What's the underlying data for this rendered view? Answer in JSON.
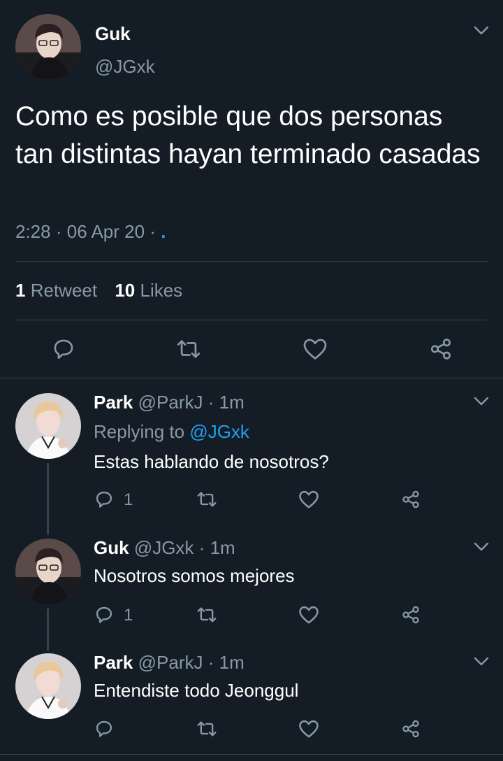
{
  "main_tweet": {
    "author_name": "Guk",
    "handle": "@JGxk",
    "text": "Como es posible que dos personas tan distintas hayan terminado casadas",
    "time": "2:28",
    "date": "06 Apr 20",
    "sep": "·",
    "dot": ".",
    "retweet_count": "1",
    "retweet_label": "Retweet",
    "likes_count": "10",
    "likes_label": "Likes"
  },
  "replies": [
    {
      "name": "Park",
      "handle": "@ParkJ",
      "sep": "·",
      "time": "1m",
      "replying_prefix": "Replying to",
      "replying_to": "@JGxk",
      "text": "Estas hablando de nosotros?",
      "reply_count": "1"
    },
    {
      "name": "Guk",
      "handle": "@JGxk",
      "sep": "·",
      "time": "1m",
      "text": "Nosotros somos mejores",
      "reply_count": "1"
    },
    {
      "name": "Park",
      "handle": "@ParkJ",
      "sep": "·",
      "time": "1m",
      "text": "Entendiste todo Jeonggul",
      "reply_count": ""
    }
  ],
  "colors": {
    "background": "#141d26",
    "text_primary": "#ffffff",
    "text_muted": "#8899a6",
    "link": "#1da1f2",
    "divider": "#38444d"
  },
  "icons": [
    "chevron-down-icon",
    "reply-icon",
    "retweet-icon",
    "like-icon",
    "share-icon"
  ]
}
